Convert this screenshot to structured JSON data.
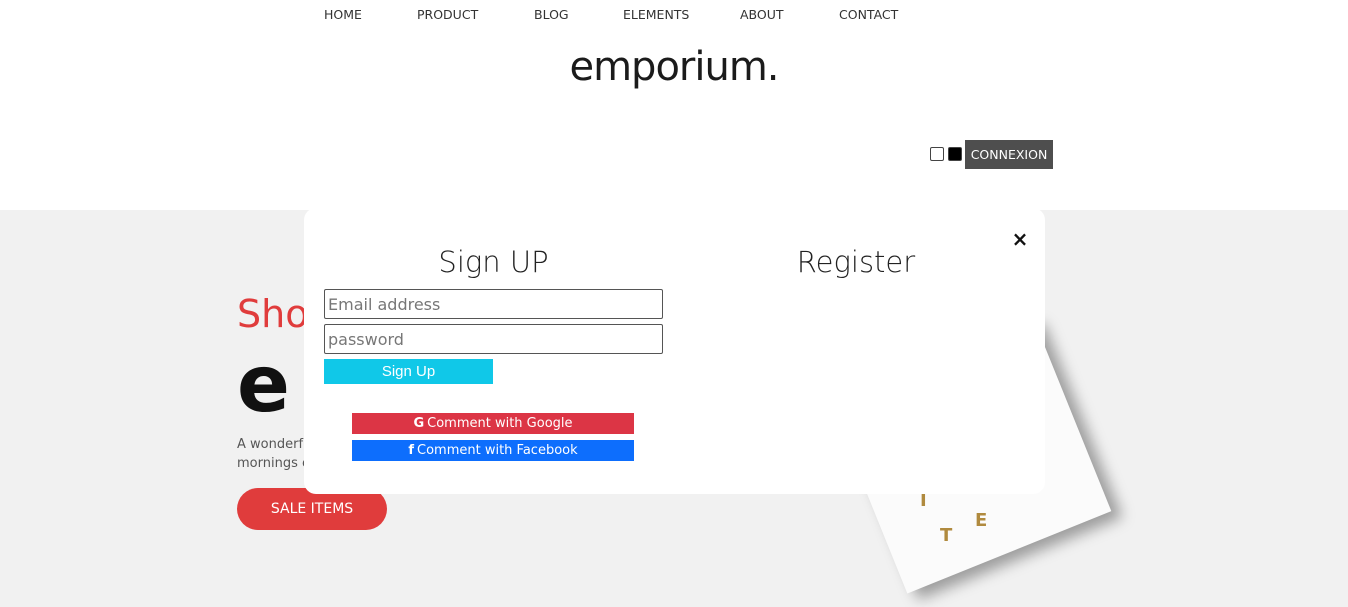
{
  "header": {
    "logo": "emporium.",
    "nav": [
      {
        "label": "HOME"
      },
      {
        "label": "PRODUCT"
      },
      {
        "label": "BLOG"
      },
      {
        "label": "ELEMENTS"
      },
      {
        "label": "ABOUT"
      },
      {
        "label": "CONTACT"
      }
    ],
    "connexion_label": "CONNEXION",
    "theme_colors": {
      "light": "#ffffff",
      "dark": "#000000"
    }
  },
  "hero": {
    "kicker": "Sho",
    "title": "e",
    "desc_line1": "A wonderfu",
    "desc_line2": "mornings c",
    "sale_label": "SALE ITEMS",
    "accent": "#e03c3c"
  },
  "shirt": {
    "letters": [
      "T",
      "E",
      "I"
    ]
  },
  "modal": {
    "close": "×",
    "signup_title": "Sign UP",
    "register_title": "Register",
    "email_placeholder": "Email address",
    "password_placeholder": "password",
    "signup_button": "Sign Up",
    "google_icon": "G",
    "google_label": "Comment with Google",
    "facebook_icon": "f",
    "facebook_label": "Comment with Facebook",
    "colors": {
      "signup": "#10c8e8",
      "google": "#dc3545",
      "facebook": "#0d6efd"
    }
  }
}
